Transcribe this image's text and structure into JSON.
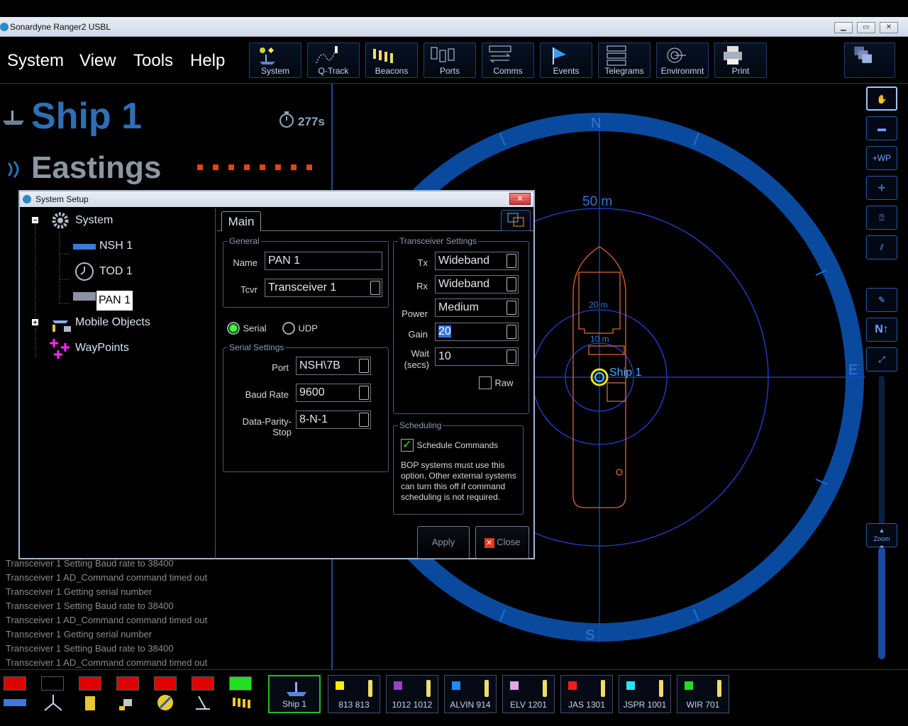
{
  "window": {
    "title": "Sonardyne Ranger2 USBL"
  },
  "menu": [
    "System",
    "View",
    "Tools",
    "Help"
  ],
  "toolbar": [
    "System",
    "Q-Track",
    "Beacons",
    "Ports",
    "Comms",
    "Events",
    "Telegrams",
    "Environmnt",
    "Print"
  ],
  "left": {
    "ship_name": "Ship 1",
    "timer": "277s",
    "eastings_label": "Eastings"
  },
  "log": [
    "Transceiver 1 Setting Baud rate to 38400",
    "Transceiver 1 AD_Command command timed out",
    "Transceiver 1 Getting serial number",
    "Transceiver 1 Setting Baud rate to 38400",
    "Transceiver 1 AD_Command command timed out",
    "Transceiver 1 Getting serial number",
    "Transceiver 1 Setting Baud rate to 38400",
    "Transceiver 1 AD_Command command timed out"
  ],
  "plot": {
    "north": "N",
    "south": "S",
    "east": "E",
    "ring_outer": "50 m",
    "ring_mid": "20 m",
    "ring_inner": "10 m",
    "ship_label": "Ship 1"
  },
  "right_tools": {
    "wp": "+WP",
    "zoom": "Zoom"
  },
  "beacons": [
    {
      "name": "Ship 1",
      "color": ""
    },
    {
      "name": "813 813",
      "color": "#ffee00"
    },
    {
      "name": "1012 1012",
      "color": "#9b3fc8"
    },
    {
      "name": "ALVIN 914",
      "color": "#1e8cff"
    },
    {
      "name": "ELV 1201",
      "color": "#e6a3e6"
    },
    {
      "name": "JAS 1301",
      "color": "#ff1a1a"
    },
    {
      "name": "JSPR 1001",
      "color": "#22e6ff"
    },
    {
      "name": "WIR 701",
      "color": "#22dd22"
    }
  ],
  "dialog": {
    "title": "System Setup",
    "tree": {
      "system": "System",
      "nsh": "NSH 1",
      "tod": "TOD 1",
      "pan": "PAN 1",
      "mobile": "Mobile Objects",
      "waypoints": "WayPoints"
    },
    "tab": "Main",
    "general": {
      "legend": "General",
      "name_label": "Name",
      "name_value": "PAN 1",
      "tcvr_label": "Tcvr",
      "tcvr_value": "Transceiver 1"
    },
    "mode": {
      "serial": "Serial",
      "udp": "UDP"
    },
    "serial": {
      "legend": "Serial Settings",
      "port_label": "Port",
      "port_value": "NSH\\7B",
      "baud_label": "Baud Rate",
      "baud_value": "9600",
      "dps_label": "Data-Parity-Stop",
      "dps_value": "8-N-1"
    },
    "transceiver": {
      "legend": "Transceiver Settings",
      "tx_label": "Tx",
      "tx_value": "Wideband",
      "rx_label": "Rx",
      "rx_value": "Wideband",
      "power_label": "Power",
      "power_value": "Medium",
      "gain_label": "Gain",
      "gain_value": "20",
      "wait_label": "Wait",
      "wait_sub": "(secs)",
      "wait_value": "10",
      "raw": "Raw"
    },
    "scheduling": {
      "legend": "Scheduling",
      "check_label": "Schedule Commands",
      "note": "BOP systems must use this option. Other external systems can turn this off if command scheduling is not required."
    },
    "apply": "Apply",
    "close": "Close"
  }
}
